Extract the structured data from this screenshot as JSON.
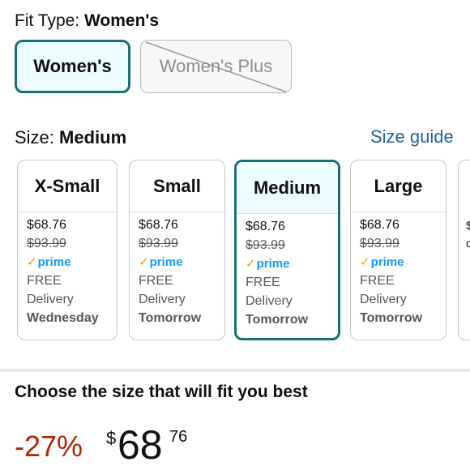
{
  "fit": {
    "label": "Fit Type: ",
    "value": "Women's",
    "options": [
      {
        "label": "Women's",
        "state": "selected"
      },
      {
        "label": "Women's Plus",
        "state": "unavailable"
      }
    ]
  },
  "size": {
    "label": "Size: ",
    "value": "Medium",
    "guide": "Size guide"
  },
  "sizes": [
    {
      "name": "X-Small",
      "price": "$68.76",
      "list_price": "$93.99",
      "prime": "prime",
      "free": "FREE",
      "delivery": "Delivery",
      "day": "Wednesday"
    },
    {
      "name": "Small",
      "price": "$68.76",
      "list_price": "$93.99",
      "prime": "prime",
      "free": "FREE",
      "delivery": "Delivery",
      "day": "Tomorrow"
    },
    {
      "name": "Medium",
      "price": "$68.76",
      "list_price": "$93.99",
      "prime": "prime",
      "free": "FREE",
      "delivery": "Delivery",
      "day": "Tomorrow"
    },
    {
      "name": "Large",
      "price": "$68.76",
      "list_price": "$93.99",
      "prime": "prime",
      "free": "FREE",
      "delivery": "Delivery",
      "day": "Tomorrow"
    }
  ],
  "partial": {
    "line1": "$",
    "line2": "c"
  },
  "choose": "Choose the size that will fit you best",
  "pricing": {
    "discount": "-27%",
    "symbol": "$",
    "whole": "68",
    "fraction": "76"
  },
  "colors": {
    "accent": "#1a6e7a",
    "selected_bg": "#edfcff",
    "link": "#2162a1",
    "prime": "#1399ff",
    "discount": "#b12704"
  }
}
